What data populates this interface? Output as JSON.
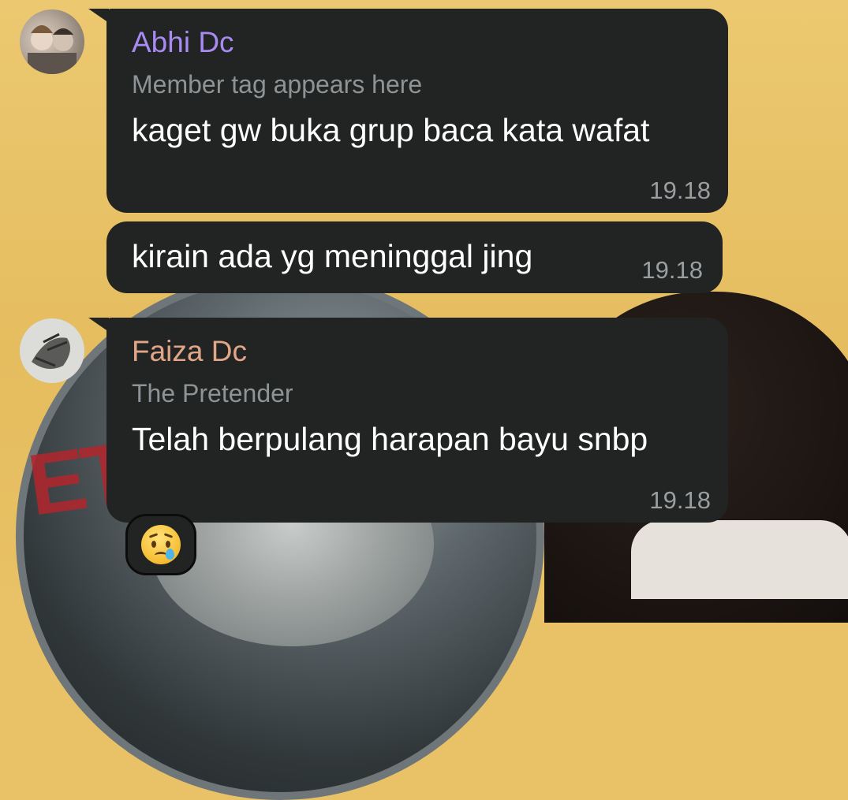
{
  "messages": [
    {
      "sender": "Abhi Dc",
      "sender_color": "#a78bf2",
      "tag": "Member tag appears here",
      "text": "kaget gw buka grup baca kata wafat",
      "time": "19.18"
    },
    {
      "text": "kirain ada yg meninggal jing",
      "time": "19.18"
    },
    {
      "sender": "Faiza Dc",
      "sender_color": "#e0a687",
      "tag": "The Pretender",
      "text": "Telah berpulang harapan bayu snbp",
      "time": "19.18"
    }
  ],
  "reaction": {
    "icon": "sad-but-relieved-face-emoji"
  },
  "wallpaper": {
    "colors": {
      "background": "#e9c267",
      "bubble": "#222424"
    }
  }
}
